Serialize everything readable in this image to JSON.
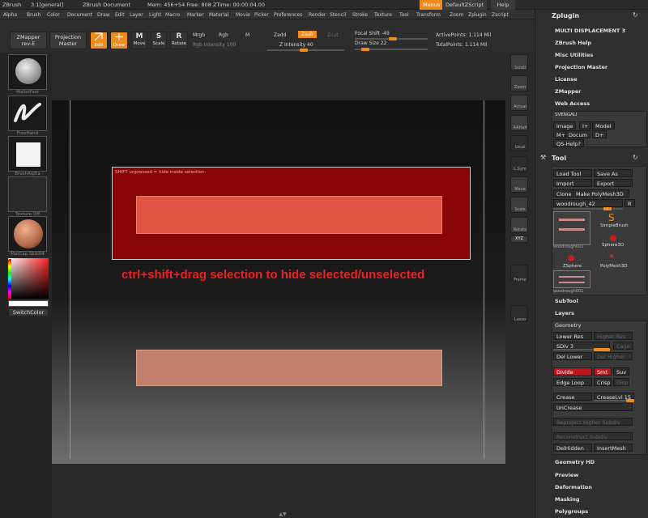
{
  "titlebar": {
    "app": "ZBrush",
    "version": "3.1[general]",
    "doc": "ZBrush Document",
    "mem": "Mem: 456+54 Free: 808 ZTime: 00:00:04.00",
    "menus": "Menus",
    "defaultzscript": "DefaultZScript",
    "help": "Help"
  },
  "menubar": [
    "Alpha",
    "Brush",
    "Color",
    "Document",
    "Draw",
    "Edit",
    "Layer",
    "Light",
    "Macro",
    "Marker",
    "Material",
    "Movie",
    "Picker",
    "Preferences",
    "Render",
    "Stencil",
    "Stroke",
    "Texture",
    "Tool",
    "Transform",
    "Zoom",
    "Zplugin",
    "Zscript"
  ],
  "toolbar": {
    "zmapper": "ZMapper",
    "zmapper_sub": "rev-E",
    "projection": "Projection",
    "projection_sub": "Master",
    "edit": "Edit",
    "draw": "Draw",
    "move": "Move",
    "scale": "Scale",
    "rotate": "Rotate",
    "mrgb": "Mrgb",
    "rgb": "Rgb",
    "m": "M",
    "rgb_intensity": "Rgb Intensity 100",
    "zadd": "Zadd",
    "zsub": "Zsub",
    "zcut": "Zcut",
    "z_intensity": "Z Intensity 40",
    "focal_shift": "Focal Shift -49",
    "draw_size": "Draw Size 22",
    "active_points": "ActivePoints: 1.114 Mil",
    "total_points": "TotalPoints: 1.114 Mil"
  },
  "lefttray": {
    "brush": "MalletFast",
    "stroke": "FreeHand",
    "alpha": "BrushAlpha",
    "texture": "Texture Off",
    "material": "MatCap Skin04",
    "switchcolor": "SwitchColor"
  },
  "rightstrip": [
    "Scroll",
    "Zoom",
    "Actual",
    "AAHalf",
    "Local",
    "L.Sym",
    "Move",
    "Scale",
    "Rotate",
    "XYZ",
    "Frame",
    "Lasso"
  ],
  "canvas": {
    "shift_note": "SHIFT unpressed = hide inside selection.",
    "caption": "ctrl+shift+drag selection to hide selected/unselected"
  },
  "zplugin": {
    "title": "Zplugin",
    "items": [
      "MULTI DISPLACEMENT 3",
      "ZBrush Help",
      "Misc Utilities",
      "Projection Master",
      "License",
      "ZMapper",
      "Web Access"
    ],
    "svengali": "SVENGALI",
    "svengali_buttons": [
      "Image",
      "I+",
      "Model",
      "M+",
      "Docum",
      "D+",
      "QS-Help?"
    ]
  },
  "tool": {
    "title": "Tool",
    "load": "Load Tool",
    "save": "Save As",
    "import": "Import",
    "export": "Export",
    "clone": "Clone",
    "make": "Make PolyMesh3D",
    "current": "woodrough_42",
    "r": "R",
    "thumbs": [
      "woodrough001",
      "SimpleBrush",
      "Sphere3D",
      "ZSphere",
      "PolyMesh3D",
      "woodrough001"
    ],
    "subtool": "SubTool",
    "layers": "Layers",
    "geometry": "Geometry",
    "lower_res": "Lower Res",
    "higher_res": "Higher Res",
    "sdiv": "SDiv 3",
    "cage": "Cage",
    "del_lower": "Del Lower",
    "del_higher": "Del Higher",
    "divide": "Divide",
    "smt": "Smt",
    "suv": "Suv",
    "edge_loop": "Edge Loop",
    "crisp": "Crisp",
    "disp": "Disp",
    "crease": "Crease",
    "creaselvl": "CreaseLvl 15",
    "uncrease": "UnCrease",
    "reproject": "Reproject Higher Subdiv",
    "reconstruct": "Reconstruct Subdiv",
    "delhidden": "DelHidden",
    "insertmesh": "InsertMesh",
    "geometry_hd": "Geometry HD",
    "preview": "Preview",
    "deformation": "Deformation",
    "masking": "Masking",
    "polygroups": "Polygroups"
  },
  "colors": {
    "accent": "#f08c1e",
    "selection": "#880505",
    "red_bar": "#e05343",
    "peach_bar": "#c2806c",
    "caption": "#f02020"
  }
}
